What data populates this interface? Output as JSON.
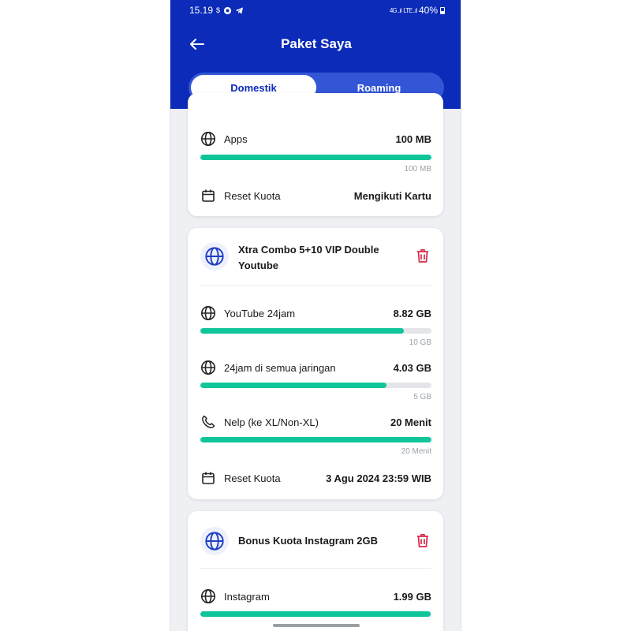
{
  "status_bar": {
    "time": "15.19",
    "battery": "40%"
  },
  "header": {
    "title": "Paket Saya"
  },
  "tabs": [
    {
      "label": "Domestik",
      "active": true
    },
    {
      "label": "Roaming",
      "active": false
    }
  ],
  "packages": [
    {
      "name": "",
      "quotas": [
        {
          "icon": "globe-icon",
          "label": "Apps",
          "remaining": "100 MB",
          "total": "100 MB",
          "fraction": 1.0
        }
      ],
      "reset_label": "Reset Kuota",
      "reset_value": "Mengikuti Kartu"
    },
    {
      "name": "Xtra Combo 5+10 VIP Double Youtube",
      "quotas": [
        {
          "icon": "globe-icon",
          "label": "YouTube 24jam",
          "remaining": "8.82 GB",
          "total": "10 GB",
          "fraction": 0.882
        },
        {
          "icon": "globe-icon",
          "label": "24jam di semua jaringan",
          "remaining": "4.03 GB",
          "total": "5 GB",
          "fraction": 0.806
        },
        {
          "icon": "phone-icon",
          "label": "Nelp (ke XL/Non-XL)",
          "remaining": "20 Menit",
          "total": "20 Menit",
          "fraction": 1.0
        }
      ],
      "reset_label": "Reset Kuota",
      "reset_value": "3 Agu 2024 23:59 WIB"
    },
    {
      "name": "Bonus Kuota Instagram 2GB",
      "quotas": [
        {
          "icon": "globe-icon",
          "label": "Instagram",
          "remaining": "1.99 GB",
          "fraction": 0.995
        }
      ]
    }
  ],
  "colors": {
    "header": "#0b2bb8",
    "progress": "#11c59a",
    "track": "#e3e5e9",
    "delete": "#d6294a"
  }
}
